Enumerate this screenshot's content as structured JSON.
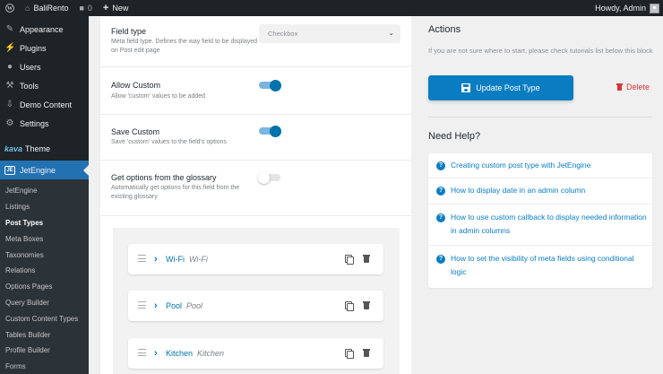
{
  "adminbar": {
    "site_name": "BaliRento",
    "comments_count": "0",
    "new_label": "New",
    "howdy": "Howdy, Admin"
  },
  "sidebar": {
    "items": [
      {
        "label": "Appearance",
        "icon": "brush-icon"
      },
      {
        "label": "Plugins",
        "icon": "plug-icon"
      },
      {
        "label": "Users",
        "icon": "user-icon"
      },
      {
        "label": "Tools",
        "icon": "wrench-icon"
      },
      {
        "label": "Demo Content",
        "icon": "download-icon"
      },
      {
        "label": "Settings",
        "icon": "settings-icon"
      }
    ],
    "brand_logo": "kava",
    "brand_item": "Theme",
    "current_item": "JetEngine",
    "submenu": [
      "JetEngine",
      "Listings",
      "Post Types",
      "Meta Boxes",
      "Taxonomies",
      "Relations",
      "Options Pages",
      "Query Builder",
      "Custom Content Types",
      "Tables Builder",
      "Profile Builder",
      "Forms"
    ],
    "active_submenu": "Post Types"
  },
  "fields": {
    "field_type": {
      "label": "Field type",
      "desc": "Meta field type. Defines the way field to be displayed on Post edit page",
      "value": "Checkbox"
    },
    "allow_custom": {
      "label": "Allow Custom",
      "desc": "Allow 'custom' values to be added",
      "on": true
    },
    "save_custom": {
      "label": "Save Custom",
      "desc": "Save 'custom' values to the field's options",
      "on": true
    },
    "glossary": {
      "label": "Get options from the glossary",
      "desc": "Automatically get options for this field from the existing glossary",
      "on": false
    }
  },
  "options": [
    {
      "title": "Wi-Fi",
      "sub": "Wi-Fi"
    },
    {
      "title": "Pool",
      "sub": "Pool"
    },
    {
      "title": "Kitchen",
      "sub": "Kitchen"
    }
  ],
  "actions": {
    "title": "Actions",
    "desc": "If you are not sure where to start, please check tutorials list below this block",
    "update_label": "Update Post Type",
    "delete_label": "Delete"
  },
  "help": {
    "title": "Need Help?",
    "links": [
      "Creating custom post type with JetEngine",
      "How to display date in an admin column",
      "How to use custom callback to display needed information in admin columns",
      "How to set the visibility of meta fields using conditional logic"
    ]
  },
  "colors": {
    "accent": "#0a7dc2",
    "admin_bg": "#1d2327",
    "current_menu": "#2271b1",
    "delete": "#d63638"
  }
}
